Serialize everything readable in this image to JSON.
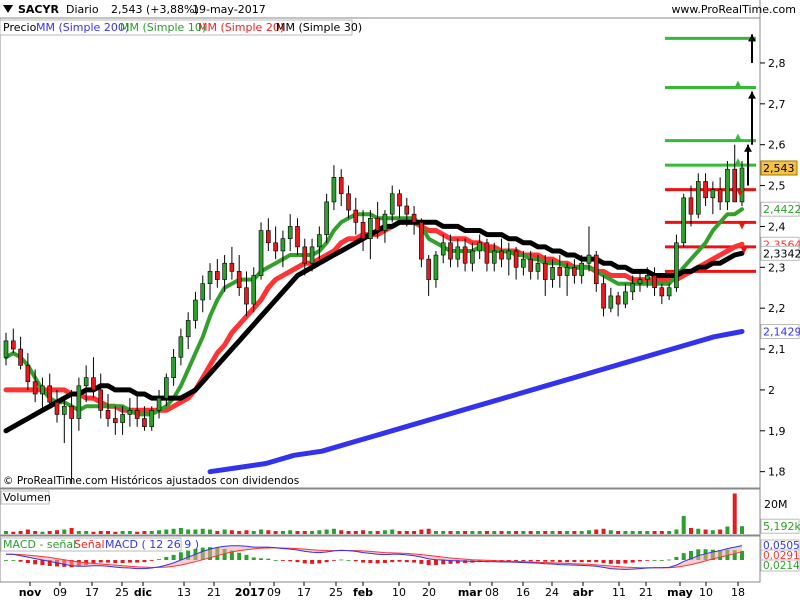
{
  "header": {
    "symbol": "SACYR",
    "period": "Diario",
    "last": "2,543 (+3,88%)",
    "date": "19-may-2017",
    "site": "www.ProRealTime.com"
  },
  "legend": {
    "price": "Precio",
    "ma200": "MM (Simple 200)",
    "ma10": "MM (Simple 10)",
    "ma20": "MM (Simple 20)",
    "ma30": "MM (Simple 30)"
  },
  "copyright": "© ProRealTime.com Históricos ajustados con dividendos",
  "volume_label": "Volumen",
  "macd_legend": {
    "diff": "MACD - señal",
    "signal": "Señal",
    "macd": "MACD ( 12 26 9 )"
  },
  "colors": {
    "up": "#2ca02c",
    "down": "#e41a1c",
    "ma200": "#3333ee",
    "ma10": "#33a02c",
    "ma20": "#ff3333",
    "ma30": "#000000",
    "level_green": "#33bb33",
    "level_red": "#ee1111",
    "current_price_bg": "#f5c242"
  },
  "chart_data": {
    "type": "candlestick",
    "y_ticks": [
      "1,8",
      "1,9",
      "2",
      "2,1",
      "2,2",
      "2,3",
      "2,4",
      "2,5",
      "2,6",
      "2,7",
      "2,8"
    ],
    "ylim": [
      1.76,
      2.91
    ],
    "price_labels": [
      {
        "value": 2.543,
        "text": "2,543"
      },
      {
        "value": 2.4422,
        "text": "2,4422"
      },
      {
        "value": 2.3564,
        "text": "2,3564"
      },
      {
        "value": 2.3342,
        "text": "2,3342"
      },
      {
        "value": 2.1429,
        "text": "2,1429"
      }
    ],
    "x_ticks": [
      "nov",
      "09",
      "17",
      "25",
      "dic",
      "13",
      "21",
      "2017",
      "09",
      "17",
      "25",
      "feb",
      "10",
      "20",
      "mar",
      "08",
      "16",
      "24",
      "abr",
      "11",
      "21",
      "may",
      "10",
      "18"
    ],
    "ohlc": [
      [
        2.08,
        2.14,
        2.06,
        2.12
      ],
      [
        2.12,
        2.15,
        2.09,
        2.1
      ],
      [
        2.1,
        2.13,
        2.05,
        2.06
      ],
      [
        2.06,
        2.09,
        2.0,
        2.02
      ],
      [
        2.02,
        2.05,
        1.97,
        1.99
      ],
      [
        1.99,
        2.03,
        1.95,
        2.01
      ],
      [
        2.01,
        2.04,
        1.96,
        1.97
      ],
      [
        1.97,
        2.0,
        1.92,
        1.94
      ],
      [
        1.94,
        1.98,
        1.87,
        1.96
      ],
      [
        1.96,
        2.0,
        1.77,
        1.93
      ],
      [
        1.93,
        2.03,
        1.9,
        2.01
      ],
      [
        2.01,
        2.06,
        1.97,
        2.03
      ],
      [
        2.03,
        2.08,
        1.98,
        2.0
      ],
      [
        2.0,
        2.04,
        1.93,
        1.95
      ],
      [
        1.95,
        1.99,
        1.91,
        1.93
      ],
      [
        1.93,
        1.96,
        1.89,
        1.92
      ],
      [
        1.92,
        1.96,
        1.89,
        1.94
      ],
      [
        1.94,
        1.98,
        1.91,
        1.95
      ],
      [
        1.95,
        1.99,
        1.91,
        1.93
      ],
      [
        1.93,
        1.96,
        1.9,
        1.91
      ],
      [
        1.91,
        1.96,
        1.9,
        1.95
      ],
      [
        1.95,
        2.0,
        1.93,
        1.98
      ],
      [
        1.98,
        2.04,
        1.96,
        2.03
      ],
      [
        2.03,
        2.1,
        2.01,
        2.08
      ],
      [
        2.08,
        2.15,
        2.06,
        2.13
      ],
      [
        2.13,
        2.19,
        2.1,
        2.17
      ],
      [
        2.17,
        2.24,
        2.15,
        2.22
      ],
      [
        2.22,
        2.28,
        2.19,
        2.26
      ],
      [
        2.26,
        2.31,
        2.22,
        2.29
      ],
      [
        2.29,
        2.32,
        2.25,
        2.27
      ],
      [
        2.27,
        2.33,
        2.24,
        2.31
      ],
      [
        2.31,
        2.35,
        2.27,
        2.29
      ],
      [
        2.29,
        2.33,
        2.23,
        2.25
      ],
      [
        2.25,
        2.29,
        2.18,
        2.21
      ],
      [
        2.21,
        2.3,
        2.19,
        2.28
      ],
      [
        2.28,
        2.41,
        2.27,
        2.39
      ],
      [
        2.39,
        2.42,
        2.34,
        2.36
      ],
      [
        2.36,
        2.4,
        2.32,
        2.34
      ],
      [
        2.34,
        2.39,
        2.3,
        2.37
      ],
      [
        2.37,
        2.43,
        2.34,
        2.4
      ],
      [
        2.4,
        2.42,
        2.33,
        2.35
      ],
      [
        2.35,
        2.37,
        2.28,
        2.31
      ],
      [
        2.31,
        2.37,
        2.29,
        2.35
      ],
      [
        2.35,
        2.4,
        2.32,
        2.38
      ],
      [
        2.38,
        2.48,
        2.36,
        2.46
      ],
      [
        2.46,
        2.55,
        2.44,
        2.52
      ],
      [
        2.52,
        2.54,
        2.45,
        2.48
      ],
      [
        2.48,
        2.5,
        2.42,
        2.44
      ],
      [
        2.44,
        2.47,
        2.38,
        2.41
      ],
      [
        2.41,
        2.44,
        2.34,
        2.37
      ],
      [
        2.37,
        2.44,
        2.32,
        2.42
      ],
      [
        2.42,
        2.46,
        2.37,
        2.39
      ],
      [
        2.39,
        2.44,
        2.36,
        2.43
      ],
      [
        2.43,
        2.5,
        2.41,
        2.48
      ],
      [
        2.48,
        2.49,
        2.42,
        2.45
      ],
      [
        2.45,
        2.47,
        2.4,
        2.43
      ],
      [
        2.43,
        2.45,
        2.38,
        2.41
      ],
      [
        2.41,
        2.42,
        2.3,
        2.32
      ],
      [
        2.32,
        2.33,
        2.23,
        2.27
      ],
      [
        2.27,
        2.34,
        2.25,
        2.33
      ],
      [
        2.33,
        2.38,
        2.31,
        2.36
      ],
      [
        2.36,
        2.38,
        2.3,
        2.32
      ],
      [
        2.32,
        2.37,
        2.3,
        2.35
      ],
      [
        2.35,
        2.37,
        2.29,
        2.31
      ],
      [
        2.31,
        2.36,
        2.29,
        2.34
      ],
      [
        2.34,
        2.38,
        2.32,
        2.36
      ],
      [
        2.36,
        2.37,
        2.29,
        2.31
      ],
      [
        2.31,
        2.36,
        2.29,
        2.34
      ],
      [
        2.34,
        2.37,
        2.3,
        2.32
      ],
      [
        2.32,
        2.36,
        2.28,
        2.34
      ],
      [
        2.34,
        2.35,
        2.27,
        2.3
      ],
      [
        2.3,
        2.34,
        2.28,
        2.32
      ],
      [
        2.32,
        2.34,
        2.27,
        2.29
      ],
      [
        2.29,
        2.33,
        2.27,
        2.31
      ],
      [
        2.31,
        2.33,
        2.23,
        2.27
      ],
      [
        2.27,
        2.32,
        2.25,
        2.3
      ],
      [
        2.3,
        2.33,
        2.25,
        2.28
      ],
      [
        2.28,
        2.31,
        2.23,
        2.3
      ],
      [
        2.3,
        2.32,
        2.26,
        2.28
      ],
      [
        2.28,
        2.33,
        2.26,
        2.31
      ],
      [
        2.31,
        2.4,
        2.29,
        2.33
      ],
      [
        2.33,
        2.34,
        2.24,
        2.26
      ],
      [
        2.26,
        2.28,
        2.18,
        2.2
      ],
      [
        2.2,
        2.25,
        2.19,
        2.23
      ],
      [
        2.23,
        2.24,
        2.18,
        2.21
      ],
      [
        2.21,
        2.26,
        2.2,
        2.24
      ],
      [
        2.24,
        2.28,
        2.22,
        2.26
      ],
      [
        2.26,
        2.29,
        2.24,
        2.27
      ],
      [
        2.27,
        2.3,
        2.25,
        2.28
      ],
      [
        2.28,
        2.3,
        2.23,
        2.25
      ],
      [
        2.25,
        2.26,
        2.21,
        2.23
      ],
      [
        2.23,
        2.26,
        2.22,
        2.25
      ],
      [
        2.25,
        2.38,
        2.24,
        2.36
      ],
      [
        2.36,
        2.48,
        2.35,
        2.47
      ],
      [
        2.47,
        2.5,
        2.4,
        2.43
      ],
      [
        2.43,
        2.53,
        2.42,
        2.51
      ],
      [
        2.51,
        2.53,
        2.45,
        2.47
      ],
      [
        2.47,
        2.51,
        2.43,
        2.49
      ],
      [
        2.49,
        2.52,
        2.44,
        2.46
      ],
      [
        2.46,
        2.56,
        2.44,
        2.54
      ],
      [
        2.54,
        2.6,
        2.48,
        2.46
      ],
      [
        2.46,
        2.56,
        2.45,
        2.543
      ]
    ],
    "ma200": [
      1.8,
      1.81,
      1.82,
      1.84,
      1.85,
      1.87,
      1.89,
      1.91,
      1.93,
      1.95,
      1.97,
      1.99,
      2.01,
      2.03,
      2.05,
      2.07,
      2.09,
      2.11,
      2.13,
      2.1429
    ],
    "ma10": [
      2.08,
      2.09,
      2.08,
      2.06,
      2.03,
      2.0,
      1.98,
      1.97,
      1.97,
      1.96,
      1.95,
      1.96,
      1.96,
      1.96,
      1.96,
      1.96,
      1.96,
      1.95,
      1.94,
      1.94,
      1.94,
      1.95,
      1.96,
      1.98,
      2.01,
      2.05,
      2.09,
      2.13,
      2.18,
      2.22,
      2.25,
      2.26,
      2.27,
      2.27,
      2.27,
      2.29,
      2.3,
      2.31,
      2.32,
      2.33,
      2.33,
      2.33,
      2.33,
      2.34,
      2.36,
      2.39,
      2.41,
      2.42,
      2.43,
      2.43,
      2.43,
      2.42,
      2.42,
      2.42,
      2.42,
      2.42,
      2.42,
      2.4,
      2.37,
      2.36,
      2.35,
      2.34,
      2.34,
      2.34,
      2.34,
      2.35,
      2.34,
      2.34,
      2.34,
      2.34,
      2.33,
      2.33,
      2.32,
      2.32,
      2.31,
      2.31,
      2.31,
      2.3,
      2.3,
      2.3,
      2.3,
      2.29,
      2.28,
      2.27,
      2.26,
      2.26,
      2.26,
      2.26,
      2.26,
      2.26,
      2.26,
      2.26,
      2.28,
      2.3,
      2.32,
      2.34,
      2.36,
      2.39,
      2.41,
      2.43,
      2.43,
      2.4422
    ],
    "ma20": [
      2.0,
      2.0,
      2.0,
      2.0,
      2.0,
      2.0,
      2.0,
      2.0,
      2.0,
      1.99,
      1.99,
      1.98,
      1.98,
      1.97,
      1.96,
      1.96,
      1.95,
      1.95,
      1.95,
      1.95,
      1.95,
      1.95,
      1.95,
      1.96,
      1.97,
      1.98,
      2.0,
      2.03,
      2.06,
      2.09,
      2.11,
      2.14,
      2.16,
      2.18,
      2.2,
      2.22,
      2.25,
      2.27,
      2.28,
      2.29,
      2.3,
      2.31,
      2.31,
      2.32,
      2.33,
      2.34,
      2.36,
      2.37,
      2.37,
      2.38,
      2.38,
      2.38,
      2.39,
      2.4,
      2.41,
      2.41,
      2.41,
      2.4,
      2.39,
      2.39,
      2.38,
      2.37,
      2.37,
      2.37,
      2.36,
      2.36,
      2.35,
      2.35,
      2.34,
      2.34,
      2.34,
      2.33,
      2.33,
      2.33,
      2.32,
      2.32,
      2.31,
      2.31,
      2.3,
      2.3,
      2.3,
      2.29,
      2.29,
      2.28,
      2.28,
      2.28,
      2.27,
      2.27,
      2.27,
      2.27,
      2.27,
      2.27,
      2.27,
      2.28,
      2.29,
      2.3,
      2.31,
      2.32,
      2.33,
      2.34,
      2.35,
      2.3564
    ],
    "ma30": [
      1.9,
      1.91,
      1.92,
      1.93,
      1.94,
      1.95,
      1.96,
      1.97,
      1.98,
      1.99,
      1.99,
      2.0,
      2.0,
      2.01,
      2.01,
      2.0,
      2.0,
      2.0,
      1.99,
      1.99,
      1.98,
      1.98,
      1.98,
      1.98,
      1.98,
      1.99,
      2.0,
      2.02,
      2.04,
      2.06,
      2.08,
      2.1,
      2.12,
      2.14,
      2.16,
      2.18,
      2.2,
      2.22,
      2.24,
      2.26,
      2.28,
      2.29,
      2.3,
      2.31,
      2.32,
      2.33,
      2.34,
      2.35,
      2.36,
      2.37,
      2.38,
      2.39,
      2.4,
      2.4,
      2.41,
      2.41,
      2.41,
      2.41,
      2.41,
      2.41,
      2.4,
      2.4,
      2.4,
      2.39,
      2.39,
      2.39,
      2.38,
      2.38,
      2.38,
      2.37,
      2.37,
      2.36,
      2.36,
      2.35,
      2.35,
      2.34,
      2.34,
      2.33,
      2.33,
      2.32,
      2.32,
      2.32,
      2.31,
      2.31,
      2.3,
      2.3,
      2.29,
      2.29,
      2.29,
      2.28,
      2.28,
      2.28,
      2.28,
      2.29,
      2.29,
      2.3,
      2.3,
      2.31,
      2.31,
      2.32,
      2.33,
      2.3342
    ],
    "levels": [
      {
        "value": 2.29,
        "color": "red"
      },
      {
        "value": 2.35,
        "color": "red"
      },
      {
        "value": 2.41,
        "color": "red"
      },
      {
        "value": 2.49,
        "color": "red"
      },
      {
        "value": 2.55,
        "color": "green"
      },
      {
        "value": 2.61,
        "color": "green"
      },
      {
        "value": 2.74,
        "color": "green"
      },
      {
        "value": 2.86,
        "color": "green"
      }
    ],
    "volume": {
      "y_ticks": [
        "20M"
      ],
      "last_label": "5,192k",
      "ylim": [
        0,
        28
      ],
      "values": [
        2,
        1.5,
        2,
        3,
        2,
        1.5,
        2,
        2.5,
        3,
        4,
        2,
        2,
        1.5,
        2,
        2,
        1.5,
        2,
        2,
        1.5,
        2,
        2,
        2.5,
        3,
        3.5,
        4,
        3,
        3,
        3.5,
        3,
        2,
        3,
        2.5,
        2,
        2.5,
        2,
        3,
        2.5,
        2,
        2,
        2.5,
        2,
        2,
        2,
        2.5,
        3,
        3.5,
        2.5,
        2,
        2,
        2.5,
        2,
        2,
        2.5,
        3,
        2,
        2,
        2,
        3,
        3.5,
        2,
        2,
        2,
        2,
        2,
        2,
        2,
        2,
        2,
        2,
        2,
        2,
        2,
        2,
        2,
        2,
        2,
        2,
        2,
        2,
        2,
        2.5,
        3,
        3.5,
        2.5,
        2,
        2,
        2,
        2,
        2,
        2,
        2,
        2,
        3,
        12,
        4,
        3.5,
        3,
        2.5,
        3,
        5,
        27,
        5.192
      ]
    },
    "macd": {
      "y_ticks": [
        {
          "value": 0.0505,
          "text": "0,0505"
        },
        {
          "value": 0.0291,
          "text": "0,0291"
        },
        {
          "value": 0.0214,
          "text": "0,0214"
        }
      ],
      "ylim": [
        -0.07,
        0.07
      ],
      "macd": [
        0.02,
        0.02,
        0.015,
        0.01,
        0.005,
        0.0,
        -0.005,
        -0.01,
        -0.015,
        -0.02,
        -0.022,
        -0.022,
        -0.02,
        -0.02,
        -0.022,
        -0.025,
        -0.027,
        -0.028,
        -0.03,
        -0.03,
        -0.028,
        -0.024,
        -0.018,
        -0.01,
        0.0,
        0.01,
        0.02,
        0.03,
        0.038,
        0.044,
        0.048,
        0.05,
        0.05,
        0.048,
        0.045,
        0.045,
        0.045,
        0.043,
        0.04,
        0.038,
        0.035,
        0.03,
        0.027,
        0.026,
        0.028,
        0.032,
        0.034,
        0.033,
        0.03,
        0.026,
        0.023,
        0.02,
        0.019,
        0.02,
        0.02,
        0.018,
        0.015,
        0.01,
        0.004,
        0.001,
        0.0,
        -0.002,
        -0.003,
        -0.004,
        -0.005,
        -0.005,
        -0.006,
        -0.006,
        -0.007,
        -0.007,
        -0.008,
        -0.009,
        -0.01,
        -0.011,
        -0.013,
        -0.014,
        -0.016,
        -0.017,
        -0.018,
        -0.019,
        -0.02,
        -0.022,
        -0.026,
        -0.03,
        -0.032,
        -0.033,
        -0.032,
        -0.03,
        -0.028,
        -0.027,
        -0.027,
        -0.026,
        -0.018,
        -0.005,
        0.005,
        0.015,
        0.022,
        0.028,
        0.033,
        0.04,
        0.045,
        0.0505
      ],
      "signal": [
        0.02,
        0.02,
        0.019,
        0.017,
        0.015,
        0.012,
        0.009,
        0.005,
        0.001,
        -0.003,
        -0.007,
        -0.01,
        -0.012,
        -0.014,
        -0.016,
        -0.018,
        -0.02,
        -0.022,
        -0.024,
        -0.025,
        -0.026,
        -0.026,
        -0.025,
        -0.022,
        -0.018,
        -0.012,
        -0.006,
        0.001,
        0.008,
        0.015,
        0.022,
        0.028,
        0.033,
        0.036,
        0.039,
        0.041,
        0.042,
        0.043,
        0.042,
        0.041,
        0.04,
        0.038,
        0.036,
        0.034,
        0.033,
        0.033,
        0.033,
        0.033,
        0.033,
        0.032,
        0.03,
        0.028,
        0.026,
        0.025,
        0.024,
        0.023,
        0.021,
        0.019,
        0.016,
        0.013,
        0.01,
        0.007,
        0.005,
        0.003,
        0.001,
        0.0,
        -0.001,
        -0.002,
        -0.003,
        -0.004,
        -0.005,
        -0.006,
        -0.007,
        -0.008,
        -0.009,
        -0.01,
        -0.011,
        -0.012,
        -0.013,
        -0.014,
        -0.015,
        -0.017,
        -0.019,
        -0.021,
        -0.023,
        -0.025,
        -0.026,
        -0.027,
        -0.027,
        -0.027,
        -0.027,
        -0.027,
        -0.025,
        -0.021,
        -0.016,
        -0.01,
        -0.003,
        0.004,
        0.01,
        0.016,
        0.022,
        0.0291
      ]
    }
  }
}
